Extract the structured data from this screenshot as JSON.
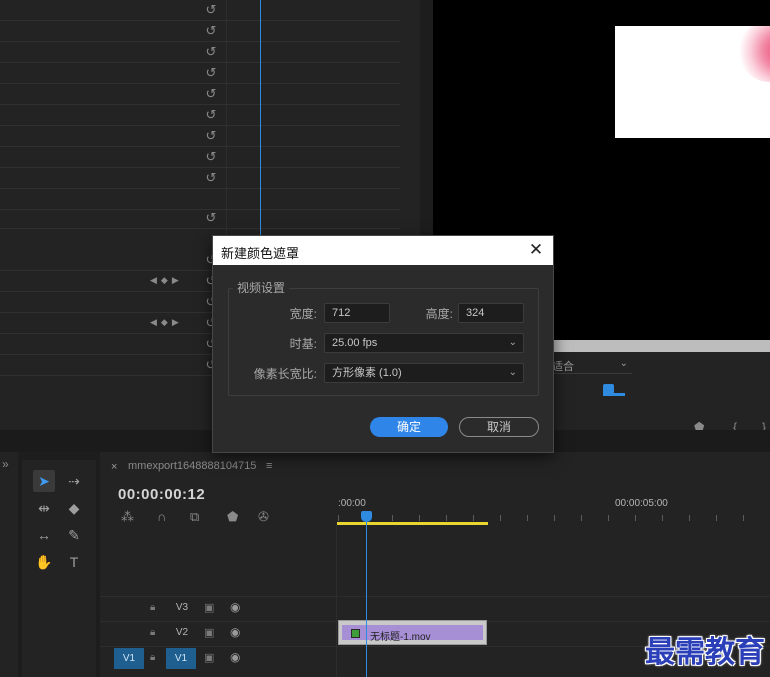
{
  "dialog": {
    "title": "新建颜色遮罩",
    "close_icon": "close-icon",
    "group_label": "视频设置",
    "width_label": "宽度:",
    "width_value": "712",
    "height_label": "高度:",
    "height_value": "324",
    "timebase_label": "时基:",
    "timebase_value": "25.00 fps",
    "pixel_aspect_label": "像素长宽比:",
    "pixel_aspect_value": "方形像素 (1.0)",
    "ok_label": "确定",
    "cancel_label": "取消"
  },
  "monitor": {
    "fit_label": "适合"
  },
  "timeline": {
    "sequence_name": "mmexport1648888104715",
    "timecode": "00:00:00:12",
    "ruler_start": ":00:00",
    "ruler_5s": "00:00:05:00",
    "tracks": [
      {
        "name": "V3",
        "source": ""
      },
      {
        "name": "V2",
        "source": ""
      },
      {
        "name": "V1",
        "source": "V1"
      }
    ],
    "clip_name": "无标题-1.mov"
  },
  "watermark": "最需教育",
  "colors": {
    "accent_blue": "#2f86e8",
    "work_area_yellow": "#e8d531",
    "clip_purple": "#a78fd6"
  }
}
